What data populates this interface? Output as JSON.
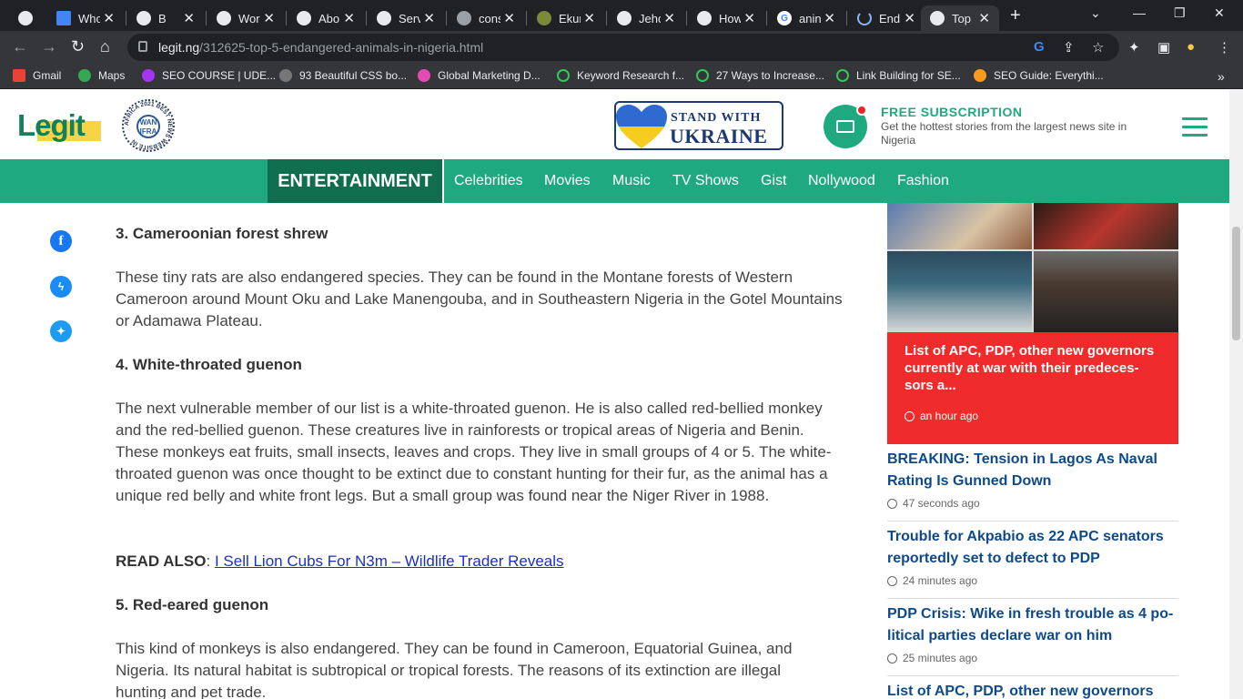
{
  "tabs": [
    {
      "title": "Who",
      "icon": "chrome-icon"
    },
    {
      "title": "B",
      "icon": "chrome-icon"
    },
    {
      "title": "Worl",
      "icon": "chrome-icon"
    },
    {
      "title": "Abo",
      "icon": "chrome-icon"
    },
    {
      "title": "Serv",
      "icon": "chrome-icon"
    },
    {
      "title": "cons",
      "icon": "site-icon"
    },
    {
      "title": "Ekur",
      "icon": "site-icon"
    },
    {
      "title": "Jeho",
      "icon": "chrome-icon"
    },
    {
      "title": "How",
      "icon": "chrome-icon"
    },
    {
      "title": "anin",
      "icon": "google-icon"
    },
    {
      "title": "End",
      "icon": "loading-icon"
    },
    {
      "title": "Top",
      "icon": "chrome-icon",
      "active": true
    }
  ],
  "address": {
    "host": "legit.ng",
    "path": "/312625-top-5-endangered-animals-in-nigeria.html"
  },
  "bookmarks": [
    {
      "label": "Gmail"
    },
    {
      "label": "Maps"
    },
    {
      "label": "SEO COURSE | UDE..."
    },
    {
      "label": "93 Beautiful CSS bo..."
    },
    {
      "label": "Global Marketing D..."
    },
    {
      "label": "Keyword Research f..."
    },
    {
      "label": "27 Ways to Increase..."
    },
    {
      "label": "Link Building for SE..."
    },
    {
      "label": "SEO Guide: Everythi..."
    }
  ],
  "header": {
    "logo": "Legit",
    "badge_text": "AFRICA 2021 BEST NEWS WEBSITE IN",
    "badge_inner": "WAN IFRA",
    "ukraine_line1": "STAND WITH",
    "ukraine_line2": "UKRAINE",
    "subscription_title": "FREE SUBSCRIPTION",
    "subscription_desc": "Get the hottest stories from the largest news site in Nigeria"
  },
  "nav": {
    "category": "ENTERTAINMENT",
    "items": [
      "Celebrities",
      "Movies",
      "Music",
      "TV Shows",
      "Gist",
      "Nollywood",
      "Fashion"
    ]
  },
  "article": {
    "h3": "3. Cameroonian forest shrew",
    "p3": "These tiny rats are also endangered species. They can be found in the Montane forests of Western Cameroon around Mount Oku and Lake Manengouba, and in Southeastern Nigeria in the Gotel Mountains or Adamawa Plateau.",
    "h4": "4. White-throated guenon",
    "p4": "The next vulnerable member of our list is a white-throated guenon. He is also called red-bellied monkey and the red-bellied guenon. These creatures live in rainforests or tropical areas of Nigeria and Benin. These monkeys eat fruits, small insects, leaves and crops. They live in small groups of 4 or 5. The white-throated guenon was once thought to be extinct due to constant hunting for their fur, as the animal has a unique red belly and white front legs. But a small group was found near the Niger River in 1988.",
    "read_also_label": "READ ALSO",
    "read_also_link": "I Sell Lion Cubs For N3m – Wildlife Trader Reveals",
    "h5": "5. Red-eared guenon",
    "p5": "This kind of monkeys is also endangered. They can be found in Cameroon, Equatorial Guinea, and Nigeria. Its natural habitat is subtropical or tropical forests. The reasons of its extinction are illegal hunting and pet trade."
  },
  "sidebar": {
    "featured_title": "List of APC, PDP, other new governors currently at war with their predeces-sors a...",
    "featured_time": "an hour ago",
    "news": [
      {
        "title": "BREAKING: Tension in Lagos As Naval Rating Is Gunned Down",
        "time": "47 seconds ago"
      },
      {
        "title": "Trouble for Akpabio as 22 APC senators reportedly set to defect to PDP",
        "time": "24 minutes ago"
      },
      {
        "title": "PDP Crisis: Wike in fresh trouble as 4 po-litical parties declare war on him",
        "time": "25 minutes ago"
      },
      {
        "title": "List of APC, PDP, other new governors",
        "time": ""
      }
    ]
  },
  "colors": {
    "brand_green": "#1fa97e",
    "dark_green": "#0e6e4e",
    "featured_red": "#ef2b2b",
    "link_blue": "#0e4a8a"
  }
}
